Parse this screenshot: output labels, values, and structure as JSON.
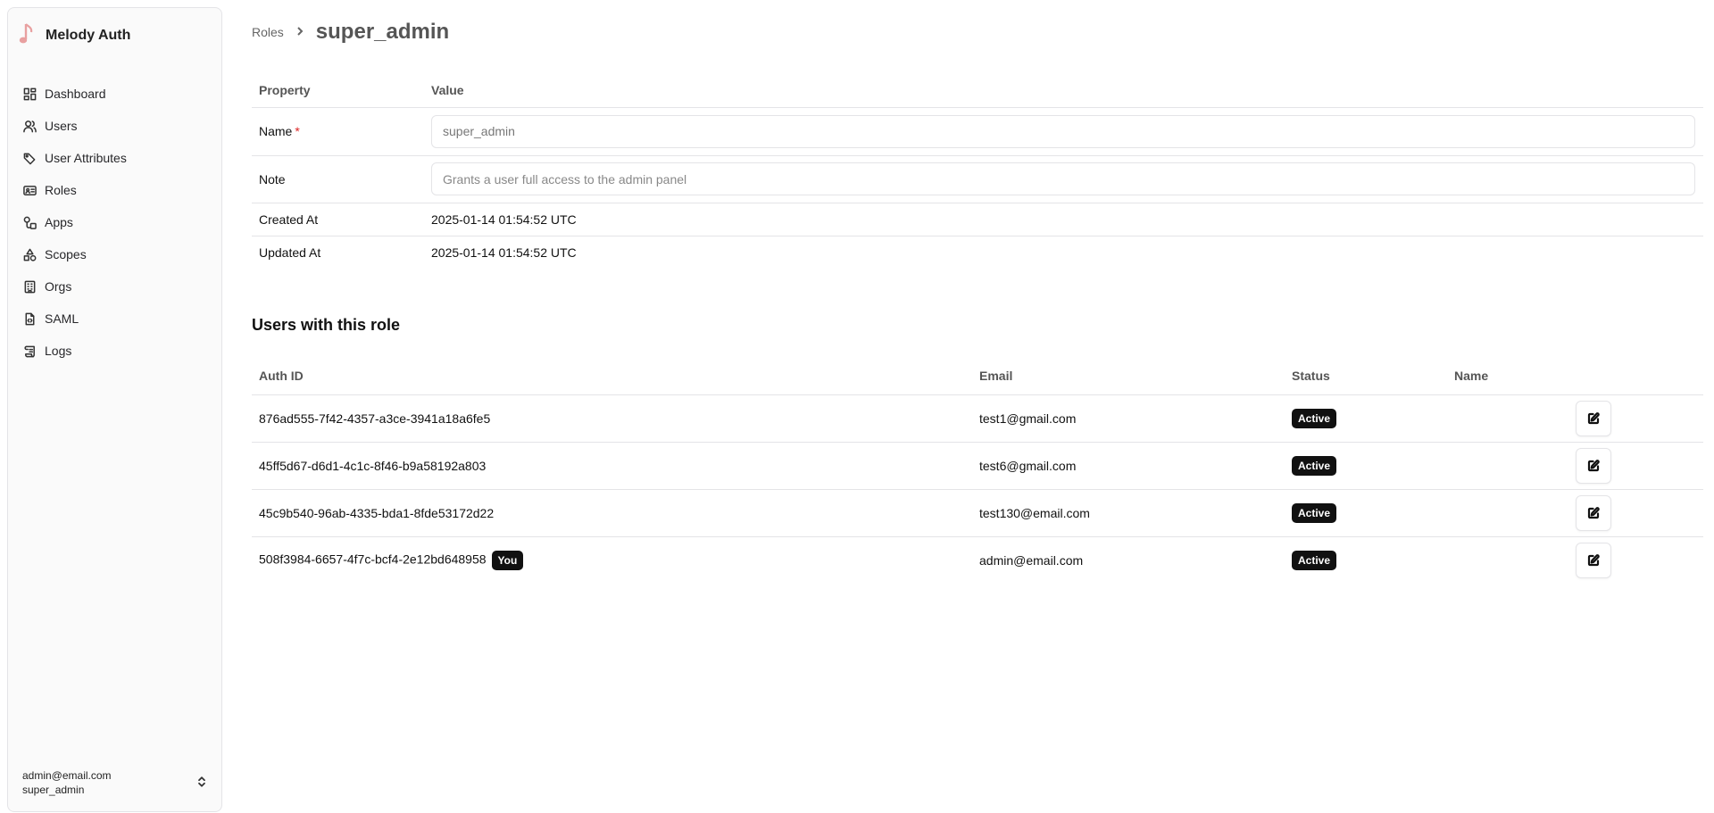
{
  "app": {
    "name": "Melody Auth",
    "logo_icon": "music-note-icon",
    "logo_color": "#e8a0a0"
  },
  "sidebar": {
    "items": [
      {
        "label": "Dashboard",
        "icon": "dashboard-icon"
      },
      {
        "label": "Users",
        "icon": "users-icon"
      },
      {
        "label": "User Attributes",
        "icon": "tag-icon"
      },
      {
        "label": "Roles",
        "icon": "id-card-icon"
      },
      {
        "label": "Apps",
        "icon": "apps-icon"
      },
      {
        "label": "Scopes",
        "icon": "shapes-icon"
      },
      {
        "label": "Orgs",
        "icon": "building-icon"
      },
      {
        "label": "SAML",
        "icon": "file-code-icon"
      },
      {
        "label": "Logs",
        "icon": "scroll-icon"
      }
    ],
    "account": {
      "email": "admin@email.com",
      "role": "super_admin"
    }
  },
  "breadcrumb": {
    "parent": "Roles",
    "current": "super_admin"
  },
  "properties": {
    "header_property": "Property",
    "header_value": "Value",
    "name_label": "Name",
    "required_mark": "*",
    "name_value": "super_admin",
    "note_label": "Note",
    "note_placeholder": "Grants a user full access to the admin panel",
    "created_label": "Created At",
    "created_value": "2025-01-14 01:54:52 UTC",
    "updated_label": "Updated At",
    "updated_value": "2025-01-14 01:54:52 UTC"
  },
  "users_section": {
    "title": "Users with this role",
    "headers": {
      "auth_id": "Auth ID",
      "email": "Email",
      "status": "Status",
      "name": "Name"
    },
    "rows": [
      {
        "auth_id": "876ad555-7f42-4357-a3ce-3941a18a6fe5",
        "email": "test1@gmail.com",
        "status": "Active",
        "name": "",
        "you": ""
      },
      {
        "auth_id": "45ff5d67-d6d1-4c1c-8f46-b9a58192a803",
        "email": "test6@gmail.com",
        "status": "Active",
        "name": "",
        "you": ""
      },
      {
        "auth_id": "45c9b540-96ab-4335-bda1-8fde53172d22",
        "email": "test130@email.com",
        "status": "Active",
        "name": "",
        "you": ""
      },
      {
        "auth_id": "508f3984-6657-4f7c-bcf4-2e12bd648958",
        "email": "admin@email.com",
        "status": "Active",
        "name": "",
        "you": "You"
      }
    ]
  }
}
